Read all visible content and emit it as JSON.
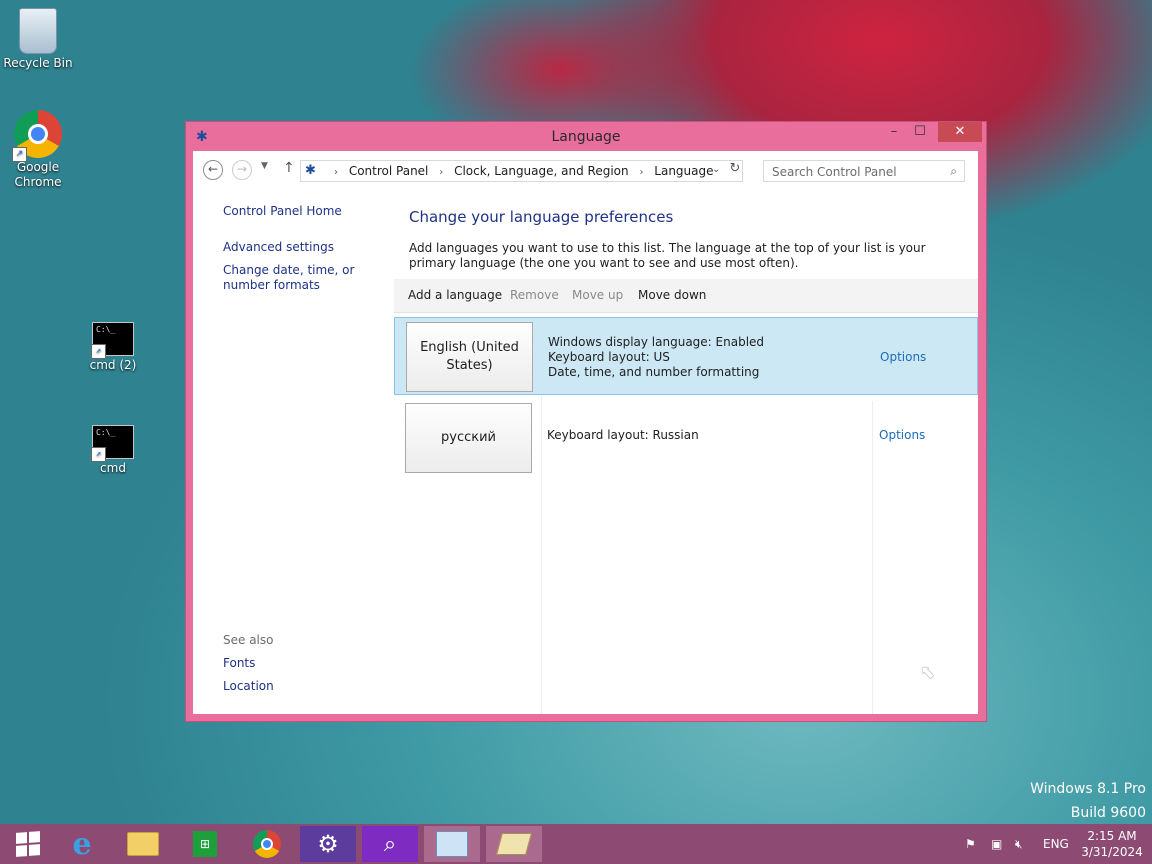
{
  "desktop": {
    "icons": [
      {
        "label": "Recycle Bin"
      },
      {
        "label": "Google Chrome"
      },
      {
        "label": "cmd (2)"
      },
      {
        "label": "cmd"
      }
    ],
    "watermark_line1": "Windows 8.1 Pro",
    "watermark_line2": "Build 9600"
  },
  "window": {
    "title": "Language",
    "controls": {
      "minimize": "–",
      "maximize": "☐",
      "close": "✕"
    },
    "address": {
      "crumbs": [
        "Control Panel",
        "Clock, Language, and Region",
        "Language"
      ],
      "search_placeholder": "Search Control Panel"
    },
    "sidebar": {
      "home": "Control Panel Home",
      "advanced": "Advanced settings",
      "datetime": "Change date, time, or number formats",
      "see_also": "See also",
      "fonts": "Fonts",
      "location": "Location"
    },
    "main": {
      "heading": "Change your language preferences",
      "description": "Add languages you want to use to this list. The language at the top of your list is your primary language (the one you want to see and use most often).",
      "toolbar": {
        "add": "Add a language",
        "remove": "Remove",
        "move_up": "Move up",
        "move_down": "Move down"
      },
      "languages": [
        {
          "name": "English (United States)",
          "info": [
            "Windows display language: Enabled",
            "Keyboard layout: US",
            "Date, time, and number formatting"
          ],
          "options": "Options",
          "selected": true
        },
        {
          "name": "русский",
          "info": [
            "Keyboard layout: Russian"
          ],
          "options": "Options",
          "selected": false
        }
      ]
    }
  },
  "taskbar": {
    "tray": {
      "lang": "ENG"
    },
    "clock": {
      "time": "2:15 AM",
      "date": "3/31/2024"
    }
  },
  "colors": {
    "window_frame": "#e96e9c",
    "taskbar": "#8d4a73",
    "link": "#1e3287",
    "selection": "#cde8f5"
  }
}
